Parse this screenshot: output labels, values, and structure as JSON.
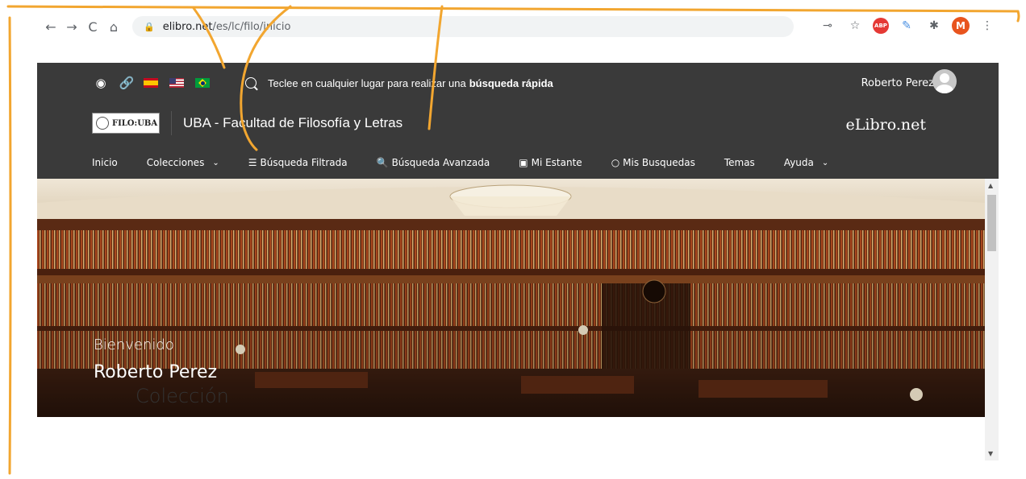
{
  "browser": {
    "back_icon": "←",
    "forward_icon": "→",
    "reload_icon": "C",
    "home_icon": "⌂",
    "lock_icon": "🔒",
    "url_host": "elibro.net",
    "url_path": "/es/lc/filo/inicio",
    "key_icon": "⊸",
    "star_icon": "☆",
    "abp_label": "ABP",
    "pen_icon": "✎",
    "puzzle_icon": "✱",
    "profile_initial": "M",
    "menu_icon": "⋮"
  },
  "header": {
    "globe_icon": "◉",
    "link_icon": "🔗",
    "quick_search_text": "Teclee en cualquier lugar para realizar una",
    "quick_search_bold": "búsqueda rápida",
    "user_name": "Roberto Perez",
    "institution_logo_text": "FILO:UBA",
    "institution_title": "UBA - Facultad de Filosofía y Letras",
    "elibro_logo": "eLibro.net"
  },
  "nav": {
    "inicio": "Inicio",
    "colecciones": "Colecciones",
    "busqueda_filtrada": "Búsqueda Filtrada",
    "busqueda_avanzada": "Búsqueda Avanzada",
    "mi_estante": "Mi Estante",
    "mis_busquedas": "Mis Busquedas",
    "temas": "Temas",
    "ayuda": "Ayuda",
    "chevron": "⌄",
    "filter_icon": "☰",
    "search_icon": "🔍",
    "shelf_icon": "▣",
    "busquedas_icon": "○"
  },
  "hero": {
    "welcome": "Bienvenido",
    "user_name": "Roberto Perez"
  },
  "section": {
    "title": "Colección"
  },
  "colors": {
    "header_bg": "#3a3a3a",
    "annotation": "#f2a630",
    "hero_wood": "#6b2e14"
  }
}
